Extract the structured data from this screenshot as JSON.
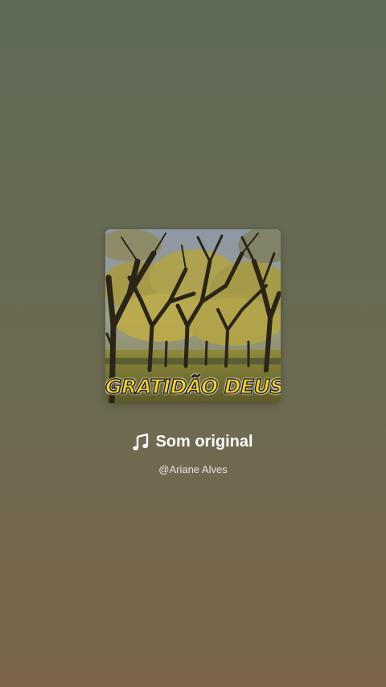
{
  "sound": {
    "title": "Som original",
    "icon": "music-note-icon",
    "author": "@Ariane Alves"
  },
  "cover": {
    "caption": "GRATIDÃO DEUS!"
  },
  "colors": {
    "background_top": "#5f6b55",
    "background_bottom": "#7a654a",
    "caption_fill": "#f6d21c",
    "text": "#ffffff"
  }
}
